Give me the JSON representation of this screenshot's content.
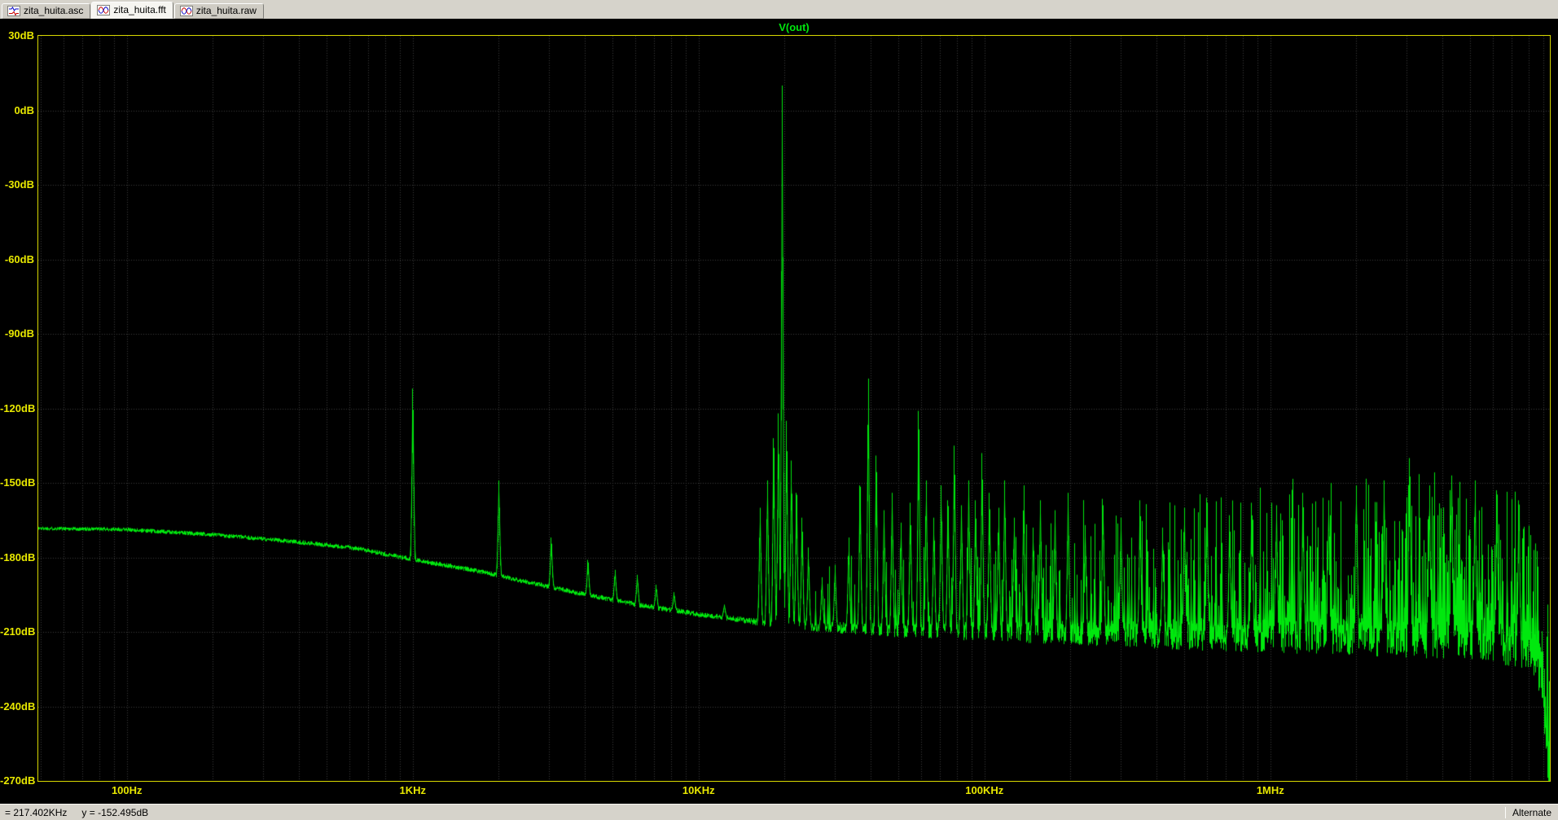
{
  "tabs": [
    {
      "label": "zita_huita.asc",
      "icon": "schematic-icon",
      "active": false
    },
    {
      "label": "zita_huita.fft",
      "icon": "fft-plot-icon",
      "active": true
    },
    {
      "label": "zita_huita.raw",
      "icon": "waveform-icon",
      "active": false
    }
  ],
  "status_bar": {
    "cursor_x": "= 217.402KHz",
    "cursor_y": "y = -152.495dB",
    "mode": "Alternate"
  },
  "chart_data": {
    "type": "line",
    "title": "V(out)",
    "series": [
      {
        "name": "V(out)",
        "color": "#00e80e"
      }
    ],
    "x_axis": {
      "scale": "log",
      "unit": "Hz",
      "min_hz": 49,
      "max_hz": 9500000,
      "ticks": [
        {
          "label": "100Hz",
          "hz": 100
        },
        {
          "label": "1KHz",
          "hz": 1000
        },
        {
          "label": "10KHz",
          "hz": 10000
        },
        {
          "label": "100KHz",
          "hz": 100000
        },
        {
          "label": "1MHz",
          "hz": 1000000
        }
      ]
    },
    "y_axis": {
      "unit": "dB",
      "max_db": 30,
      "min_db": -270,
      "tick_step_db": 30,
      "ticks": [
        "30dB",
        "0dB",
        "-30dB",
        "-60dB",
        "-90dB",
        "-120dB",
        "-150dB",
        "-180dB",
        "-210dB",
        "-240dB",
        "-270dB"
      ]
    },
    "grid": {
      "visible": true,
      "style": "dotted",
      "color": "#3c3c3c"
    },
    "colors": {
      "background": "#000000",
      "border": "#d8d800",
      "labels": "#e8e800"
    },
    "noise_floor_db_by_logf": [
      [
        1.69,
        -168
      ],
      [
        2.0,
        -168.5
      ],
      [
        2.3,
        -170.5
      ],
      [
        2.6,
        -173.5
      ],
      [
        2.8,
        -176
      ],
      [
        3.0,
        -180.5
      ],
      [
        3.2,
        -184.5
      ],
      [
        3.4,
        -189.5
      ],
      [
        3.6,
        -194.5
      ],
      [
        3.8,
        -199
      ],
      [
        4.0,
        -202.5
      ],
      [
        4.2,
        -205.5
      ],
      [
        4.45,
        -207.5
      ],
      [
        4.7,
        -208.5
      ],
      [
        5.2,
        -209
      ],
      [
        6.0,
        -209.5
      ],
      [
        6.5,
        -210
      ],
      [
        6.78,
        -211.5
      ],
      [
        6.88,
        -214
      ],
      [
        6.93,
        -221
      ],
      [
        6.955,
        -233
      ],
      [
        6.97,
        -255
      ],
      [
        6.978,
        -292
      ]
    ],
    "peaks_hz_db": [
      [
        1000,
        -112
      ],
      [
        2000,
        -149
      ],
      [
        3050,
        -172
      ],
      [
        4100,
        -181
      ],
      [
        5100,
        -185
      ],
      [
        6100,
        -187
      ],
      [
        7100,
        -191
      ],
      [
        8200,
        -194
      ],
      [
        12300,
        -199
      ],
      [
        16400,
        -160
      ],
      [
        17400,
        -149
      ],
      [
        18300,
        -132
      ],
      [
        19000,
        -122
      ],
      [
        19600,
        10
      ],
      [
        20300,
        -125
      ],
      [
        21100,
        -141
      ],
      [
        22000,
        -154
      ],
      [
        23000,
        -164
      ],
      [
        24200,
        -176
      ],
      [
        27000,
        -188
      ],
      [
        30000,
        -183
      ],
      [
        33500,
        -172
      ],
      [
        36700,
        -151
      ],
      [
        39200,
        -108
      ],
      [
        41800,
        -139
      ],
      [
        44500,
        -161
      ],
      [
        47500,
        -154
      ],
      [
        51000,
        -166
      ],
      [
        55000,
        -158
      ],
      [
        58800,
        -121
      ],
      [
        62500,
        -149
      ],
      [
        66500,
        -164
      ],
      [
        70500,
        -151
      ],
      [
        74500,
        -157
      ],
      [
        78400,
        -135
      ],
      [
        83000,
        -159
      ],
      [
        88000,
        -149
      ],
      [
        93000,
        -157
      ],
      [
        98000,
        -138
      ],
      [
        104000,
        -154
      ],
      [
        112000,
        -160
      ],
      [
        117600,
        -149
      ],
      [
        127000,
        -164
      ],
      [
        137200,
        -151
      ],
      [
        148000,
        -168
      ],
      [
        156800,
        -157
      ],
      [
        176400,
        -161
      ],
      [
        196000,
        -154
      ],
      [
        225000,
        -167
      ],
      [
        260000,
        -159
      ],
      [
        300000,
        -164
      ],
      [
        350000,
        -157
      ],
      [
        420000,
        -168
      ],
      [
        500000,
        -160
      ],
      [
        600000,
        -156
      ],
      [
        720000,
        -163
      ],
      [
        860000,
        -158
      ],
      [
        1050000,
        -159
      ],
      [
        1300000,
        -154
      ],
      [
        1600000,
        -157
      ],
      [
        2000000,
        -151
      ],
      [
        2500000,
        -149
      ],
      [
        3070000,
        -140
      ],
      [
        3600000,
        -151
      ],
      [
        4300000,
        -147
      ],
      [
        5200000,
        -149
      ],
      [
        6200000,
        -153
      ],
      [
        7400000,
        -157
      ]
    ],
    "noise_texture": {
      "seed": 1337,
      "spike_start_logf": 4.33,
      "spike_prob_slope": 0.22,
      "spike_prob_max": 0.52,
      "spike_max_db": [
        [
          4.35,
          22
        ],
        [
          4.8,
          40
        ],
        [
          5.3,
          50
        ],
        [
          5.9,
          57
        ],
        [
          6.5,
          62
        ],
        [
          6.98,
          64
        ]
      ],
      "band_halfwidth_db": [
        [
          1.69,
          0.7
        ],
        [
          4.1,
          1.0
        ],
        [
          4.6,
          2.5
        ],
        [
          5.2,
          4.5
        ],
        [
          5.8,
          6.5
        ],
        [
          6.4,
          8
        ],
        [
          6.98,
          9
        ]
      ]
    }
  }
}
